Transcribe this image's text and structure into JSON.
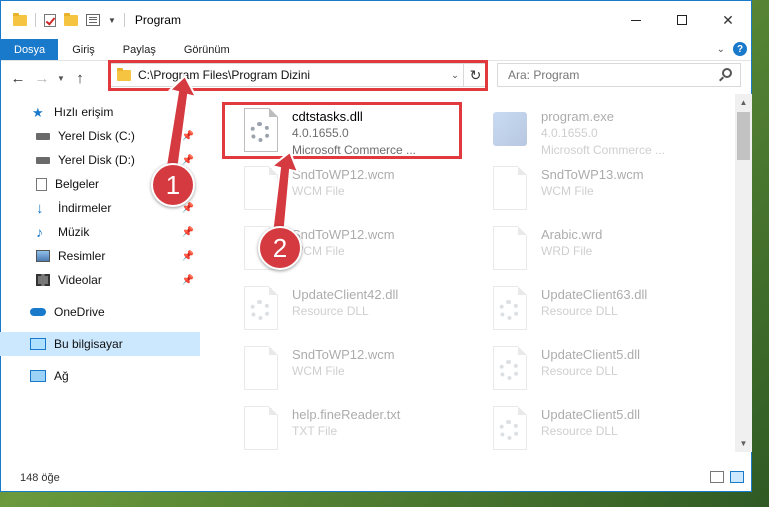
{
  "window": {
    "title": "Program"
  },
  "ribbon": {
    "tabs": [
      "Dosya",
      "Giriş",
      "Paylaş",
      "Görünüm"
    ]
  },
  "address": {
    "path": "C:\\Program Files\\Program Dizini"
  },
  "search": {
    "placeholder": "Ara: Program"
  },
  "sidebar": {
    "items": [
      {
        "label": "Hızlı erişim",
        "icon": "star-icon"
      },
      {
        "label": "Yerel Disk (C:)",
        "icon": "drive-icon"
      },
      {
        "label": "Yerel Disk (D:)",
        "icon": "drive-icon"
      },
      {
        "label": "Belgeler",
        "icon": "documents-icon"
      },
      {
        "label": "İndirmeler",
        "icon": "download-icon"
      },
      {
        "label": "Müzik",
        "icon": "music-icon"
      },
      {
        "label": "Resimler",
        "icon": "pictures-icon"
      },
      {
        "label": "Videolar",
        "icon": "video-icon"
      },
      {
        "label": "OneDrive",
        "icon": "cloud-icon"
      },
      {
        "label": "Bu bilgisayar",
        "icon": "computer-icon"
      },
      {
        "label": "Ağ",
        "icon": "network-icon"
      }
    ]
  },
  "files": [
    {
      "name": "cdtstasks.dll",
      "line2": "4.0.1655.0",
      "line3": "Microsoft Commerce ...",
      "icon": "dll-gear-icon"
    },
    {
      "name": "program.exe",
      "line2": "4.0.1655.0",
      "line3": "Microsoft Commerce ...",
      "icon": "exe-icon"
    },
    {
      "name": "SndToWP12.wcm",
      "line2": "WCM File",
      "icon": "file-icon"
    },
    {
      "name": "SndToWP13.wcm",
      "line2": "WCM File",
      "icon": "file-icon"
    },
    {
      "name": "SndToWP12.wcm",
      "line2": "WCM File",
      "icon": "file-icon"
    },
    {
      "name": "Arabic.wrd",
      "line2": "WRD File",
      "icon": "file-icon"
    },
    {
      "name": "UpdateClient42.dll",
      "line2": "Resource DLL",
      "icon": "dll-gear-icon"
    },
    {
      "name": "UpdateClient63.dll",
      "line2": "Resource DLL",
      "icon": "dll-gear-icon"
    },
    {
      "name": "SndToWP12.wcm",
      "line2": "WCM File",
      "icon": "file-icon"
    },
    {
      "name": "UpdateClient5.dll",
      "line2": "Resource DLL",
      "icon": "dll-gear-icon"
    },
    {
      "name": "help.fineReader.txt",
      "line2": "TXT File",
      "icon": "file-icon"
    },
    {
      "name": "UpdateClient5.dll",
      "line2": "Resource DLL",
      "icon": "dll-gear-icon"
    }
  ],
  "status": {
    "count": "148 öğe"
  },
  "annotations": {
    "step1": "1",
    "step2": "2",
    "color": "#d43a3f"
  }
}
